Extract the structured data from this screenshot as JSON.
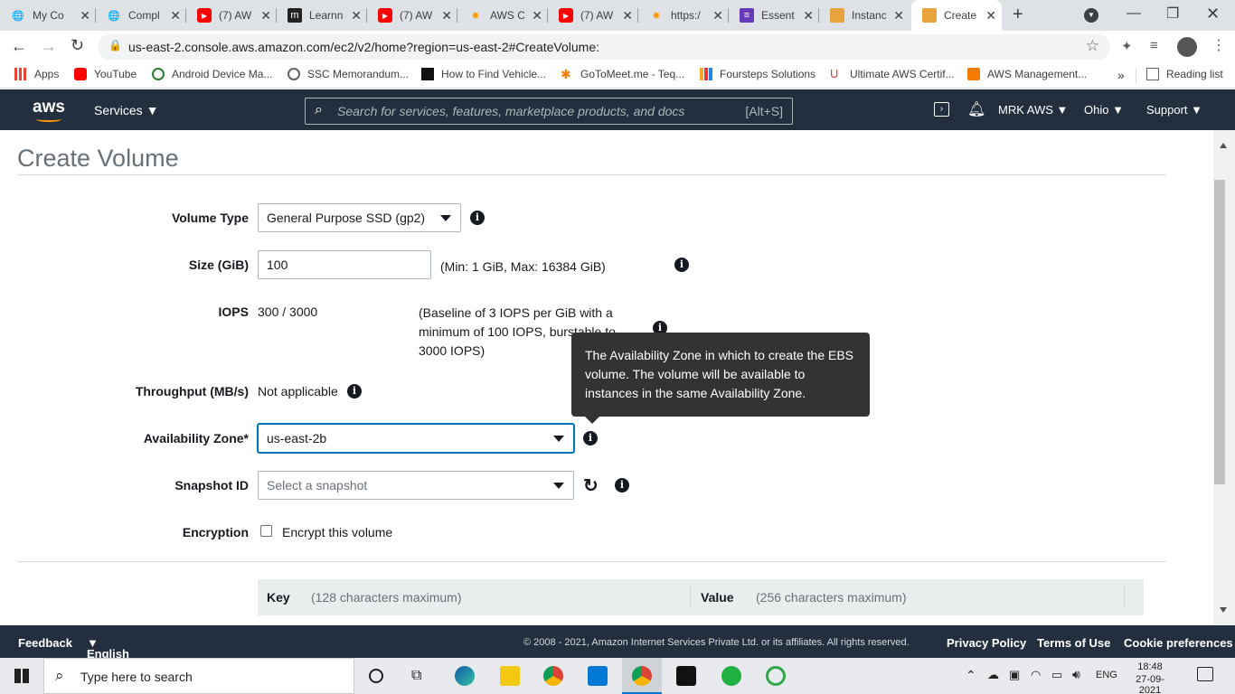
{
  "browser": {
    "tabs": [
      {
        "title": "My Co",
        "icon": "globe-icon"
      },
      {
        "title": "Compl",
        "icon": "globe-icon"
      },
      {
        "title": "(7) AW",
        "icon": "youtube-icon"
      },
      {
        "title": "Learnn",
        "icon": "m-icon"
      },
      {
        "title": "(7) AW",
        "icon": "youtube-icon"
      },
      {
        "title": "AWS C",
        "icon": "aws-star-icon"
      },
      {
        "title": "(7) AW",
        "icon": "youtube-icon"
      },
      {
        "title": "https:/",
        "icon": "aws-star-icon"
      },
      {
        "title": "Essent",
        "icon": "list-icon"
      },
      {
        "title": "Instanc",
        "icon": "cube-icon"
      },
      {
        "title": "Create",
        "icon": "cube-icon"
      }
    ],
    "url": "us-east-2.console.aws.amazon.com/ec2/v2/home?region=us-east-2#CreateVolume:",
    "bookmarks": [
      "Apps",
      "YouTube",
      "Android Device Ma...",
      "SSC Memorandum...",
      "How to Find Vehicle...",
      "GoToMeet.me - Teq...",
      "Foursteps Solutions",
      "Ultimate AWS Certif...",
      "AWS Management..."
    ],
    "reading_list": "Reading list",
    "more": "»"
  },
  "aws_header": {
    "logo": "aws",
    "services": "Services",
    "search_placeholder": "Search for services, features, marketplace products, and docs",
    "search_shortcut": "[Alt+S]",
    "account": "MRK AWS",
    "region": "Ohio",
    "support": "Support"
  },
  "form": {
    "title": "Create Volume",
    "volume_type_label": "Volume Type",
    "volume_type_value": "General Purpose SSD (gp2)",
    "size_label": "Size (GiB)",
    "size_value": "100",
    "size_hint": "(Min: 1 GiB, Max: 16384 GiB)",
    "iops_label": "IOPS",
    "iops_value": "300 / 3000",
    "iops_hint_1": "(Baseline of 3 IOPS per GiB with a",
    "iops_hint_2": "minimum of 100 IOPS, burstable to",
    "iops_hint_3": "3000 IOPS)",
    "throughput_label": "Throughput (MB/s)",
    "throughput_value": "Not applicable",
    "az_label": "Availability Zone*",
    "az_value": "us-east-2b",
    "snapshot_label": "Snapshot ID",
    "snapshot_placeholder": "Select a snapshot",
    "encryption_label": "Encryption",
    "encryption_checkbox": "Encrypt this volume",
    "tooltip_1": "The Availability Zone in which to create the EBS",
    "tooltip_2": "volume. The volume will be available to",
    "tooltip_3": "instances in the same Availability Zone.",
    "tag_key": "Key",
    "tag_key_hint": "(128 characters maximum)",
    "tag_value": "Value",
    "tag_value_hint": "(256 characters maximum)"
  },
  "footer": {
    "feedback": "Feedback",
    "language": "English (US)",
    "copyright": "© 2008 - 2021, Amazon Internet Services Private Ltd. or its affiliates. All rights reserved.",
    "privacy": "Privacy Policy",
    "terms": "Terms of Use",
    "cookie": "Cookie preferences"
  },
  "taskbar": {
    "search": "Type here to search",
    "lang": "ENG",
    "time": "18:48",
    "date": "27-09-2021"
  },
  "colors": {
    "aws_nav": "#232f3e",
    "tooltip": "#333333"
  }
}
